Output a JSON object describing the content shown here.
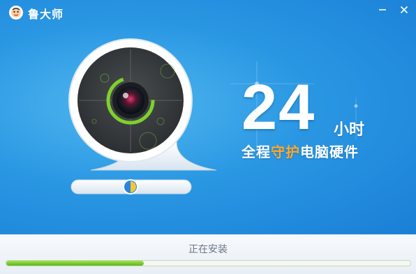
{
  "app": {
    "title": "鲁大师",
    "logo_icon": "ludashi-logo-icon"
  },
  "window_controls": {
    "minimize_icon": "minimize-icon",
    "close_icon": "close-icon"
  },
  "banner": {
    "number": "24",
    "unit": "小时",
    "tagline_pre": "全程",
    "tagline_highlight": "守护",
    "tagline_post": "电脑硬件",
    "highlight_color": "#ffa92a",
    "illustration_icon": "webcam-icon"
  },
  "install": {
    "status": "正在安装",
    "progress_fraction": 0.34
  },
  "colors": {
    "background_blue": "#2a97e3",
    "progress_green": "#58b916",
    "camera_ring": "#7fd12b"
  }
}
